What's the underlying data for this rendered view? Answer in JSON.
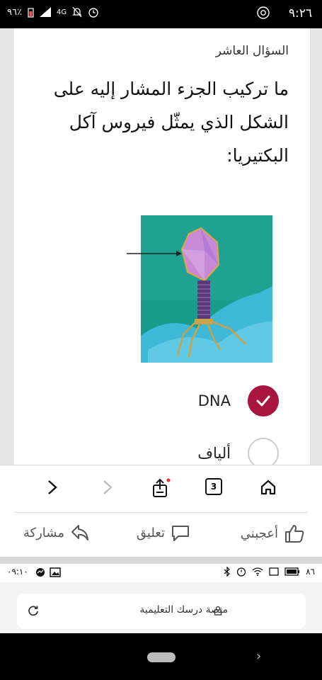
{
  "status_bar": {
    "time": "٩:٢٦",
    "battery": "٩٦٪",
    "network": "4G"
  },
  "question": {
    "number": "السؤال العاشر",
    "text": "ما تركيب الجزء المشار إليه على الشكل الذي يمثّل فيروس آكل البكتيريا:"
  },
  "options": [
    {
      "label": "DNA",
      "selected": true
    },
    {
      "label": "ألياف",
      "selected": false
    }
  ],
  "toolbar": {
    "page_count": "3"
  },
  "actions": {
    "like": "أعجبني",
    "comment": "تعليق",
    "share": "مشاركة"
  },
  "status_bar_2": {
    "time": "٠٩:١٠",
    "battery": "٨٦"
  },
  "url_bar": {
    "site": "منصة درسك التعليمية"
  },
  "colors": {
    "accent": "#a8153f",
    "image_bg": "#1a9a8a"
  }
}
